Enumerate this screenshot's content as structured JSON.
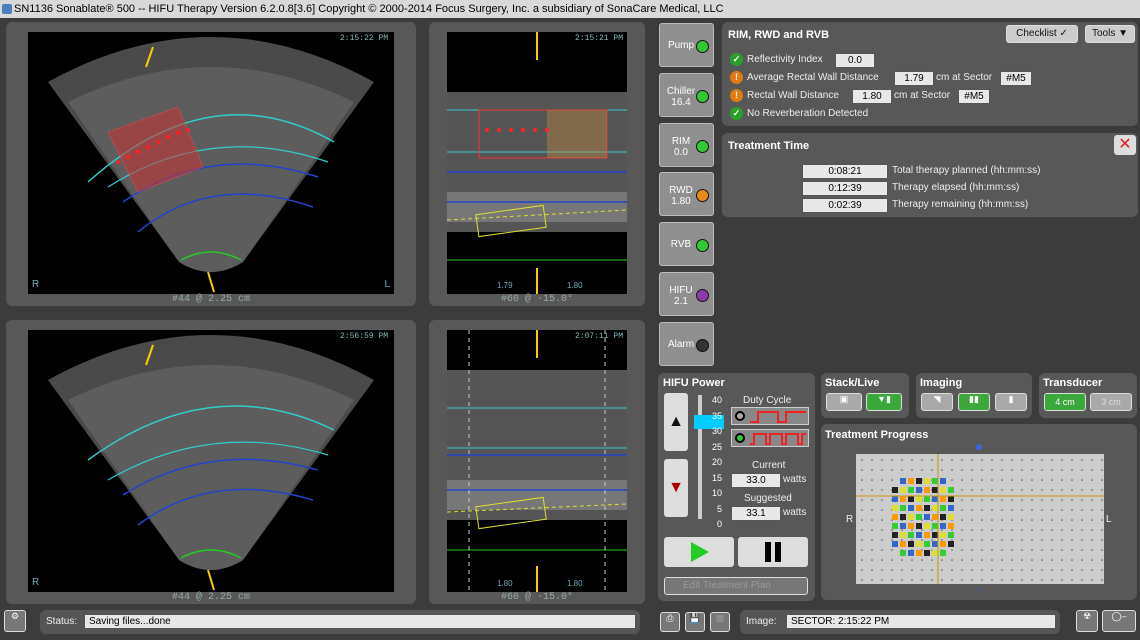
{
  "window": {
    "title": "SN1136 Sonablate® 500 -- HIFU Therapy Version 6.2.0.8[3.6] Copyright © 2000-2014 Focus Surgery, Inc. a subsidiary of SonaCare Medical, LLC"
  },
  "views": [
    {
      "time": "2:15:22 PM",
      "caption": "#44 @ 2.25 cm",
      "right": "L",
      "left": "R"
    },
    {
      "time": "2:15:21 PM",
      "caption": "#60 @ -15.0°",
      "readout1": "1.79",
      "readout2": "1.80"
    },
    {
      "time": "2:56:59 PM",
      "caption": "#44 @ 2.25 cm",
      "right": "L",
      "left": "R"
    },
    {
      "time": "2:07:11 PM",
      "caption": "#60 @ -15.0°",
      "readout1": "1.80",
      "readout2": "1.80"
    }
  ],
  "side_buttons": [
    {
      "label": "Pump",
      "value": "",
      "status": "green"
    },
    {
      "label": "Chiller",
      "value": "16.4",
      "status": "green"
    },
    {
      "label": "RIM",
      "value": "0.0",
      "status": "green"
    },
    {
      "label": "RWD",
      "value": "1.80",
      "status": "orange"
    },
    {
      "label": "RVB",
      "value": "",
      "status": "green"
    },
    {
      "label": "HIFU",
      "value": "2.1",
      "status": "purple"
    },
    {
      "label": "Alarm",
      "value": "",
      "status": "off"
    }
  ],
  "rim": {
    "title": "RIM, RWD and RVB",
    "checklist": "Checklist",
    "tools": "Tools",
    "reflectivity_label": "Reflectivity Index",
    "reflectivity_value": "0.0",
    "avg_label": "Average Rectal Wall Distance",
    "avg_value": "1.79",
    "avg_unit": "cm at Sector",
    "avg_sector": "#M5",
    "rwd_label": "Rectal Wall Distance",
    "rwd_value": "1.80",
    "rwd_unit": "cm at Sector",
    "rwd_sector": "#M5",
    "reverb_label": "No Reverberation Detected"
  },
  "treatment_time": {
    "title": "Treatment Time",
    "rows": [
      {
        "value": "0:08:21",
        "label": "Total therapy planned (hh:mm:ss)"
      },
      {
        "value": "0:12:39",
        "label": "Therapy elapsed (hh:mm:ss)"
      },
      {
        "value": "0:02:39",
        "label": "Therapy remaining (hh:mm:ss)"
      }
    ]
  },
  "hifu_power": {
    "title": "HIFU Power",
    "scale": [
      "40",
      "35",
      "30",
      "25",
      "20",
      "15",
      "10",
      "5",
      "0"
    ],
    "duty_cycle_label": "Duty Cycle",
    "current_label": "Current",
    "current_value": "33.0",
    "current_unit": "watts",
    "suggested_label": "Suggested",
    "suggested_value": "33.1",
    "suggested_unit": "watts",
    "edit_plan": "Edit Treatment Plan"
  },
  "stack_live": {
    "title": "Stack/Live"
  },
  "imaging": {
    "title": "Imaging"
  },
  "transducer": {
    "title": "Transducer",
    "opt1": "4 cm",
    "opt2": "3 cm"
  },
  "progress": {
    "title": "Treatment Progress",
    "left": "R",
    "right": "L"
  },
  "status": {
    "label": "Status:",
    "value": "Saving files...done"
  },
  "image": {
    "label": "Image:",
    "value": "SECTOR: 2:15:22 PM"
  }
}
